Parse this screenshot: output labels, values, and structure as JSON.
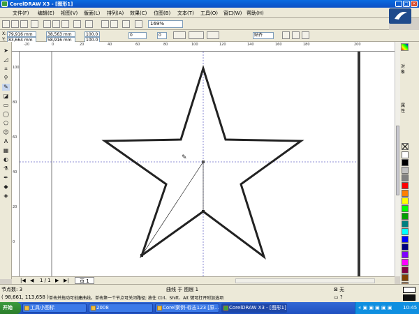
{
  "window": {
    "title": "CorelDRAW X3 - [图形1]"
  },
  "menu": [
    "文件(F)",
    "编辑(E)",
    "视图(V)",
    "版面(L)",
    "排列(A)",
    "效果(C)",
    "位图(B)",
    "文本(T)",
    "工具(O)",
    "窗口(W)",
    "帮助(H)"
  ],
  "toolbar": {
    "zoom_value": "169%",
    "snap_label": "贴齐"
  },
  "propbar": {
    "x": "79,916 mm",
    "y": "83,664 mm",
    "w": "38,563 mm",
    "h": "58,916 mm",
    "scale_x": "100.0",
    "scale_y": "100.0",
    "angle": "0",
    "dup": "0"
  },
  "ruler": {
    "h_ticks": [
      "-20",
      "0",
      "20",
      "40",
      "60",
      "80",
      "100",
      "120",
      "140",
      "160",
      "180",
      "200"
    ],
    "v_ticks": [
      "100",
      "80",
      "60",
      "40",
      "20",
      "0"
    ]
  },
  "pages": {
    "counter": "1 / 1",
    "tab": "页 1"
  },
  "status": {
    "nodes": "节点数: 3",
    "curve": "曲线 于 图层 1",
    "coords": "( 98,661, 113,658 )",
    "hint": "单击并拖动可创建曲线。单击第一个节点可关闭路径; 按住 Ctrl、Shift、Alt 键可打开附加选项",
    "fill_none": "无"
  },
  "taskbar": {
    "start": "开始",
    "tasks": [
      "工具小图标",
      "2008",
      "Corel案例-标志123 [原...",
      "CorelDRAW X3 - [图形1]"
    ],
    "time": "10:45"
  },
  "palette_colors": [
    "#ffffff",
    "#000000",
    "#c0c0c0",
    "#808080",
    "#ff0000",
    "#ff8000",
    "#ffff00",
    "#00ff00",
    "#00a000",
    "#008080",
    "#00ffff",
    "#0000ff",
    "#000080",
    "#8000ff",
    "#ff00ff",
    "#800040",
    "#804000",
    "#a08060",
    "#c0a080",
    "#e0c0a0",
    "#60a0ff",
    "#a0c0ff",
    "#8080c0",
    "#606080",
    "#404040",
    "#f0f0f0",
    "#d0d0d0",
    "#b0b0b0",
    "#909090",
    "#707070"
  ]
}
